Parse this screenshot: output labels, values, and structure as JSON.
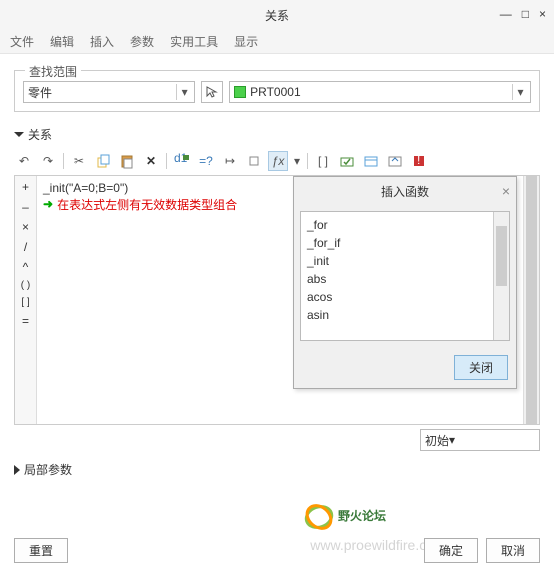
{
  "window": {
    "title": "关系"
  },
  "controls": {
    "min": "—",
    "max": "□",
    "close": "×"
  },
  "menu": [
    "文件",
    "编辑",
    "插入",
    "参数",
    "实用工具",
    "显示"
  ],
  "scope": {
    "legend": "查找范围",
    "type": "零件",
    "part": "PRT0001"
  },
  "sections": {
    "relations": "关系",
    "localparams": "局部参数"
  },
  "toolbar_icons": [
    "undo",
    "redo",
    "cut",
    "copy",
    "paste",
    "delete",
    "dims",
    "goto",
    "bracket-l",
    "bracket-r",
    "fx",
    "brackets",
    "validate",
    "table",
    "reorder",
    "flag"
  ],
  "gutter": [
    "+",
    "–",
    "×",
    "/",
    "^",
    "( )",
    "[ ]",
    "="
  ],
  "code": {
    "line1": "_init(\"A=0;B=0\")",
    "error": "在表达式左侧有无效数据类型组合"
  },
  "popup": {
    "title": "插入函数",
    "items": [
      "_for",
      "_for_if",
      "_init",
      "abs",
      "acos",
      "asin"
    ],
    "close_btn": "关闭"
  },
  "init_label": "初始",
  "buttons": {
    "reset": "重置",
    "ok": "确定",
    "cancel": "取消"
  },
  "watermark": "www.proewildfire.cn",
  "logo_text": "野火论坛"
}
